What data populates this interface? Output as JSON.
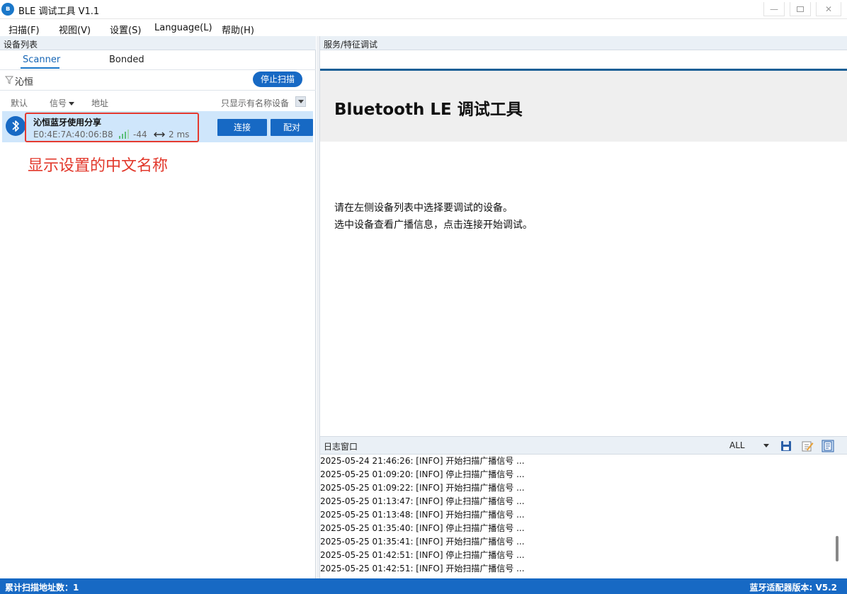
{
  "window": {
    "title": "BLE 调试工具 V1.1",
    "app_icon": "bluetooth-logo"
  },
  "menu": [
    "扫描(F)",
    "视图(V)",
    "设置(S)",
    "Language(L)",
    "帮助(H)"
  ],
  "left_pane": {
    "header": "设备列表",
    "tabs": [
      {
        "label": "Scanner",
        "active": true
      },
      {
        "label": "Bonded",
        "active": false
      }
    ],
    "filter_text": "沁恒",
    "stop_scan_label": "停止扫描",
    "columns": {
      "default": "默认",
      "signal": "信号",
      "address": "地址"
    },
    "named_only_label": "只显示有名称设备",
    "devices": [
      {
        "name": "沁恒蓝牙使用分享",
        "address": "E0:4E:7A:40:06:B8",
        "rssi": "-44",
        "interval": "2 ms",
        "connect_label": "连接",
        "pair_label": "配对"
      }
    ],
    "annotation": "显示设置的中文名称"
  },
  "right_pane": {
    "header": "服务/特征调试",
    "banner_title": "Bluetooth LE 调试工具",
    "hint_line1": "请在左侧设备列表中选择要调试的设备。",
    "hint_line2": "选中设备查看广播信息，点击连接开始调试。"
  },
  "log": {
    "title": "日志窗口",
    "level": "ALL",
    "lines": [
      "2025-05-24 21:46:26: [INFO] 开始扫描广播信号 ...",
      "2025-05-25 01:09:20: [INFO] 停止扫描广播信号 ...",
      "2025-05-25 01:09:22: [INFO] 开始扫描广播信号 ...",
      "2025-05-25 01:13:47: [INFO] 停止扫描广播信号 ...",
      "2025-05-25 01:13:48: [INFO] 开始扫描广播信号 ...",
      "2025-05-25 01:35:40: [INFO] 停止扫描广播信号 ...",
      "2025-05-25 01:35:41: [INFO] 开始扫描广播信号 ...",
      "2025-05-25 01:42:51: [INFO] 停止扫描广播信号 ...",
      "2025-05-25 01:42:51: [INFO] 开始扫描广播信号 ..."
    ]
  },
  "status": {
    "left": "累计扫描地址数：1",
    "right": "蓝牙适配器版本: V5.2"
  },
  "colors": {
    "accent": "#1769c4",
    "selected_row": "#cfe6fb",
    "annotation_red": "#e2382b"
  }
}
